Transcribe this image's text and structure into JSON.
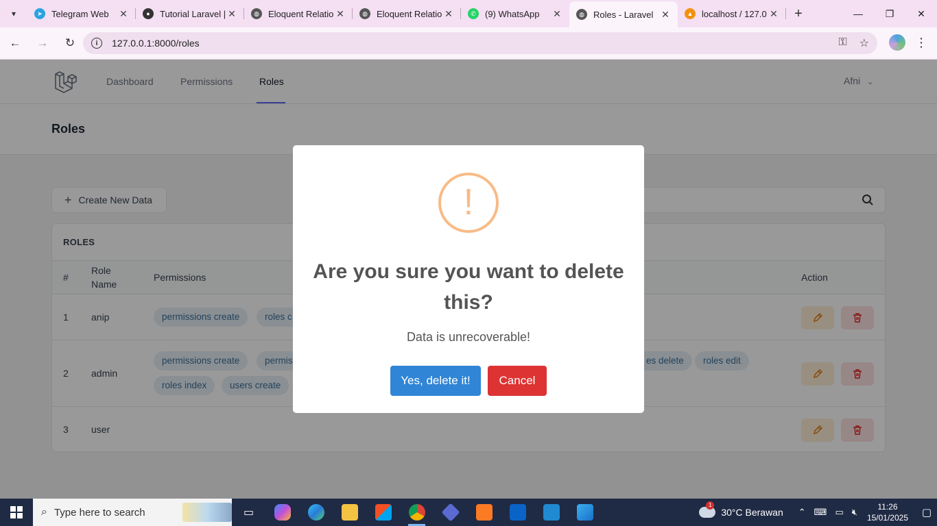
{
  "browser": {
    "tabs": [
      {
        "title": "Telegram Web",
        "icon": "telegram-icon",
        "color": "#2aa3e0"
      },
      {
        "title": "Tutorial Laravel |",
        "icon": "github-icon",
        "color": "#333333"
      },
      {
        "title": "Eloquent Relatio",
        "icon": "globe-icon",
        "color": "#555555"
      },
      {
        "title": "Eloquent Relatio",
        "icon": "globe-icon",
        "color": "#555555"
      },
      {
        "title": "(9) WhatsApp",
        "icon": "whatsapp-icon",
        "color": "#25d366"
      },
      {
        "title": "Roles - Laravel",
        "icon": "globe-icon",
        "color": "#555555",
        "active": true
      },
      {
        "title": "localhost / 127.0",
        "icon": "phpmyadmin-icon",
        "color": "#f29111"
      }
    ],
    "url": "127.0.0.1:8000/roles"
  },
  "nav": {
    "links": [
      "Dashboard",
      "Permissions",
      "Roles"
    ],
    "active": "Roles",
    "user": "Afni"
  },
  "page": {
    "title": "Roles",
    "create_label": "Create New Data",
    "card_title": "ROLES",
    "columns": {
      "num": "#",
      "role_name_1": "Role",
      "role_name_2": "Name",
      "permissions": "Permissions",
      "action": "Action"
    },
    "rows": [
      {
        "num": "1",
        "name": "anip",
        "badges": [
          "permissions create",
          "roles c"
        ]
      },
      {
        "num": "2",
        "name": "admin",
        "badges": [
          "permissions create",
          "permis",
          "es delete",
          "roles edit",
          "roles index",
          "users create"
        ]
      },
      {
        "num": "3",
        "name": "user",
        "badges": []
      }
    ]
  },
  "modal": {
    "icon": "!",
    "title": "Are you sure you want to delete this?",
    "text": "Data is unrecoverable!",
    "confirm": "Yes, delete it!",
    "cancel": "Cancel",
    "confirm_color": "#3085d6",
    "cancel_color": "#dd3333",
    "warning_color": "#f8bb86"
  },
  "taskbar": {
    "search_placeholder": "Type here to search",
    "weather": "30°C  Berawan",
    "weather_badge": "1",
    "time": "11:26",
    "date": "15/01/2025"
  }
}
